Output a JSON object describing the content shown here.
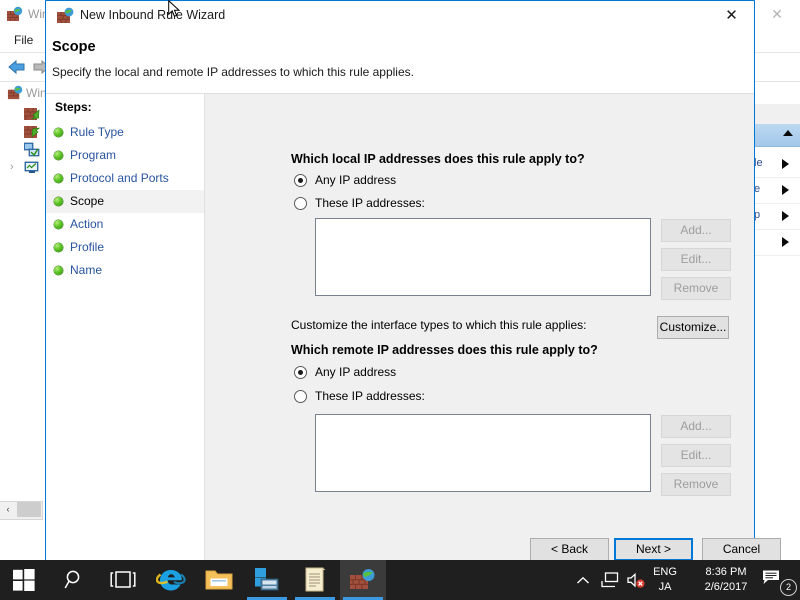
{
  "background_window": {
    "title": "Windows Firewall with Advanced Security",
    "icon": "firewall-icon",
    "close_label": "✕",
    "menus": [
      "File"
    ],
    "tree_root": "Windows Firewall with Advanced Security on Loc",
    "tree_nodes": [
      {
        "icon": "inbound-rules-icon",
        "label": ""
      },
      {
        "icon": "outbound-rules-icon",
        "label": ""
      },
      {
        "icon": "connection-security-rules-icon",
        "label": ""
      },
      {
        "icon": "monitoring-icon",
        "label": ""
      }
    ],
    "nav_back": "back-arrow",
    "nav_forward": "forward-arrow",
    "scroll_left": "‹",
    "actions": [
      {
        "label": "le"
      },
      {
        "label": "e"
      },
      {
        "label": "p"
      },
      {
        "label": ""
      }
    ]
  },
  "dialog": {
    "title": "New Inbound Rule Wizard",
    "icon": "firewall-icon",
    "close_label": "✕",
    "heading": "Scope",
    "subheading": "Specify the local and remote IP addresses to which this rule applies.",
    "steps_title": "Steps:",
    "steps": [
      {
        "label": "Rule Type",
        "current": false
      },
      {
        "label": "Program",
        "current": false
      },
      {
        "label": "Protocol and Ports",
        "current": false
      },
      {
        "label": "Scope",
        "current": true
      },
      {
        "label": "Action",
        "current": false
      },
      {
        "label": "Profile",
        "current": false
      },
      {
        "label": "Name",
        "current": false
      }
    ],
    "local": {
      "heading": "Which local IP addresses does this rule apply to?",
      "option_any": "Any IP address",
      "option_these": "These IP addresses:",
      "selected": "any",
      "list_items": [],
      "add_label": "Add...",
      "edit_label": "Edit...",
      "remove_label": "Remove",
      "add_enabled": false,
      "edit_enabled": false,
      "remove_enabled": false
    },
    "interface": {
      "text": "Customize the interface types to which this rule applies:",
      "customize_label": "Customize..."
    },
    "remote": {
      "heading": "Which remote IP addresses does this rule apply to?",
      "option_any": "Any IP address",
      "option_these": "These IP addresses:",
      "selected": "any",
      "list_items": [],
      "add_label": "Add...",
      "edit_label": "Edit...",
      "remove_label": "Remove",
      "add_enabled": false,
      "edit_enabled": false,
      "remove_enabled": false
    },
    "footer": {
      "back_label": "< Back",
      "next_label": "Next >",
      "cancel_label": "Cancel",
      "default_button": "next"
    }
  },
  "taskbar": {
    "start_icon": "windows-logo-icon",
    "items": [
      {
        "icon": "search-icon",
        "running": false,
        "active": false
      },
      {
        "icon": "task-view-icon",
        "running": false,
        "active": false
      },
      {
        "icon": "internet-explorer-icon",
        "running": false,
        "active": false
      },
      {
        "icon": "file-explorer-icon",
        "running": false,
        "active": false
      },
      {
        "icon": "server-manager-icon",
        "running": true,
        "active": false
      },
      {
        "icon": "notepad-icon",
        "running": true,
        "active": false
      },
      {
        "icon": "firewall-icon",
        "running": true,
        "active": true
      }
    ],
    "tray": {
      "show_hidden_icon": "chevron-up-icon",
      "network_icon": "network-icon",
      "volume_icon": "volume-muted-icon",
      "language_line1": "ENG",
      "language_line2": "JA",
      "time": "8:36 PM",
      "date": "2/6/2017",
      "notification_icon": "action-center-icon",
      "notification_count": "2"
    }
  },
  "colors": {
    "dialog_border": "#0078d7",
    "link": "#27539e",
    "accent": "#0078d7",
    "taskbar_bg": "#1f1f1f",
    "body_bg": "#f0f0f0"
  }
}
